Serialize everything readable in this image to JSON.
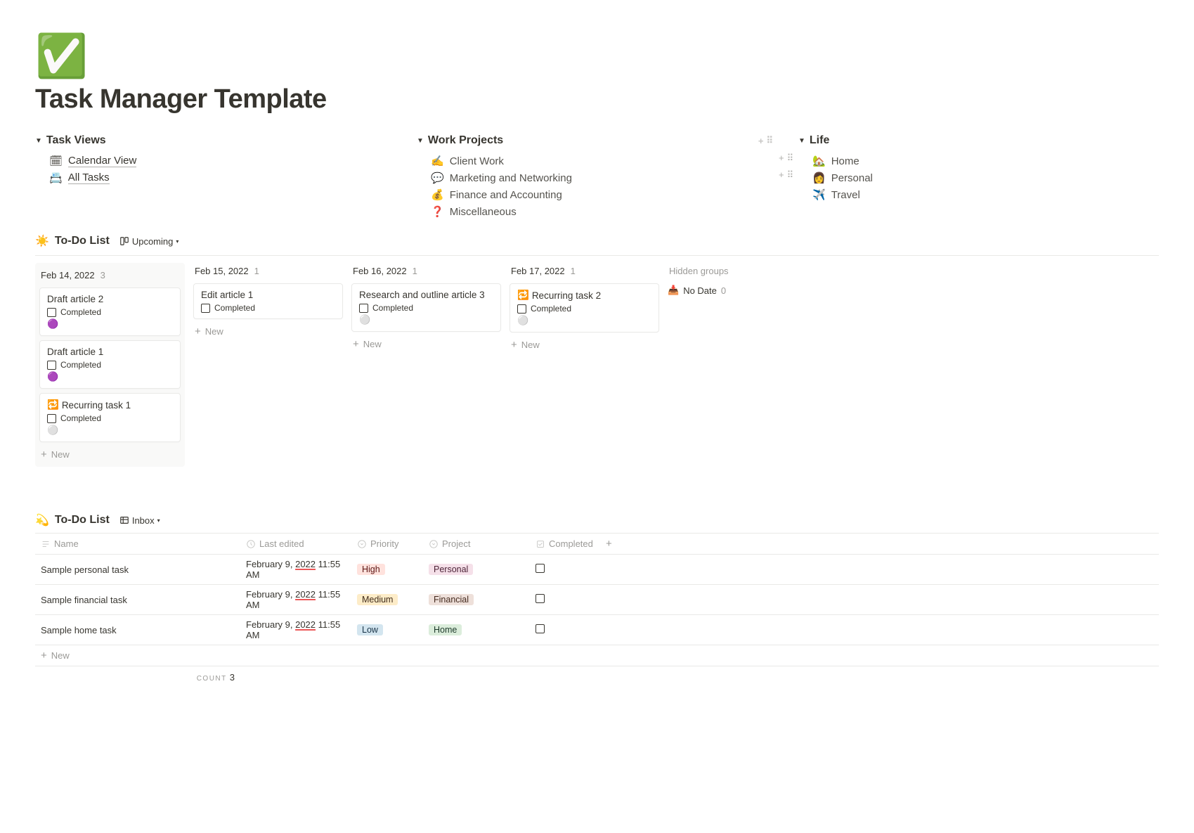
{
  "page_icon": "✅",
  "page_title": "Task Manager Template",
  "task_views": {
    "heading": "Task Views",
    "items": [
      {
        "icon": "🗓",
        "label": "Calendar View"
      },
      {
        "icon": "📇",
        "label": "All Tasks"
      }
    ]
  },
  "work_projects": {
    "heading": "Work Projects",
    "items": [
      {
        "icon": "✍️",
        "label": "Client Work"
      },
      {
        "icon": "💬",
        "label": "Marketing and Networking"
      },
      {
        "icon": "💰",
        "label": "Finance and Accounting"
      },
      {
        "icon": "❓",
        "label": "Miscellaneous"
      }
    ]
  },
  "life": {
    "heading": "Life",
    "items": [
      {
        "icon": "🏡",
        "label": "Home"
      },
      {
        "icon": "👩",
        "label": "Personal"
      },
      {
        "icon": "✈️",
        "label": "Travel"
      }
    ]
  },
  "todo_board": {
    "icon": "☀️",
    "title": "To-Do List",
    "view_label": "Upcoming",
    "new_label": "New",
    "completed_label": "Completed",
    "hidden_label": "Hidden groups",
    "no_date_label": "No Date",
    "no_date_count": "0",
    "columns": [
      {
        "date": "Feb 14, 2022",
        "count": "3",
        "cards": [
          {
            "title": "Draft article 2",
            "dot": "🟣"
          },
          {
            "title": "Draft article 1",
            "dot": "🟣"
          },
          {
            "title": "Recurring task 1",
            "icon": "🔁",
            "dot": "⚪"
          }
        ]
      },
      {
        "date": "Feb 15, 2022",
        "count": "1",
        "cards": [
          {
            "title": "Edit article 1",
            "dot": ""
          }
        ]
      },
      {
        "date": "Feb 16, 2022",
        "count": "1",
        "cards": [
          {
            "title": "Research and outline article 3",
            "dot": "⚪"
          }
        ]
      },
      {
        "date": "Feb 17, 2022",
        "count": "1",
        "cards": [
          {
            "title": "Recurring task 2",
            "icon": "🔁",
            "dot": "⚪"
          }
        ]
      }
    ]
  },
  "todo_table": {
    "icon": "💫",
    "title": "To-Do List",
    "view_label": "Inbox",
    "new_label": "New",
    "count_label": "COUNT",
    "count_value": "3",
    "headers": {
      "name": "Name",
      "last_edited": "Last edited",
      "priority": "Priority",
      "project": "Project",
      "completed": "Completed"
    },
    "rows": [
      {
        "name": "Sample personal task",
        "edited_prefix": "February 9, ",
        "edited_year": "2022",
        "edited_time": " 11:55 AM",
        "priority": "High",
        "priority_class": "high",
        "project": "Personal",
        "project_class": "personal"
      },
      {
        "name": "Sample financial task",
        "edited_prefix": "February 9, ",
        "edited_year": "2022",
        "edited_time": " 11:55 AM",
        "priority": "Medium",
        "priority_class": "med",
        "project": "Financial",
        "project_class": "financial"
      },
      {
        "name": "Sample home task",
        "edited_prefix": "February 9, ",
        "edited_year": "2022",
        "edited_time": " 11:55 AM",
        "priority": "Low",
        "priority_class": "low",
        "project": "Home",
        "project_class": "home"
      }
    ]
  }
}
